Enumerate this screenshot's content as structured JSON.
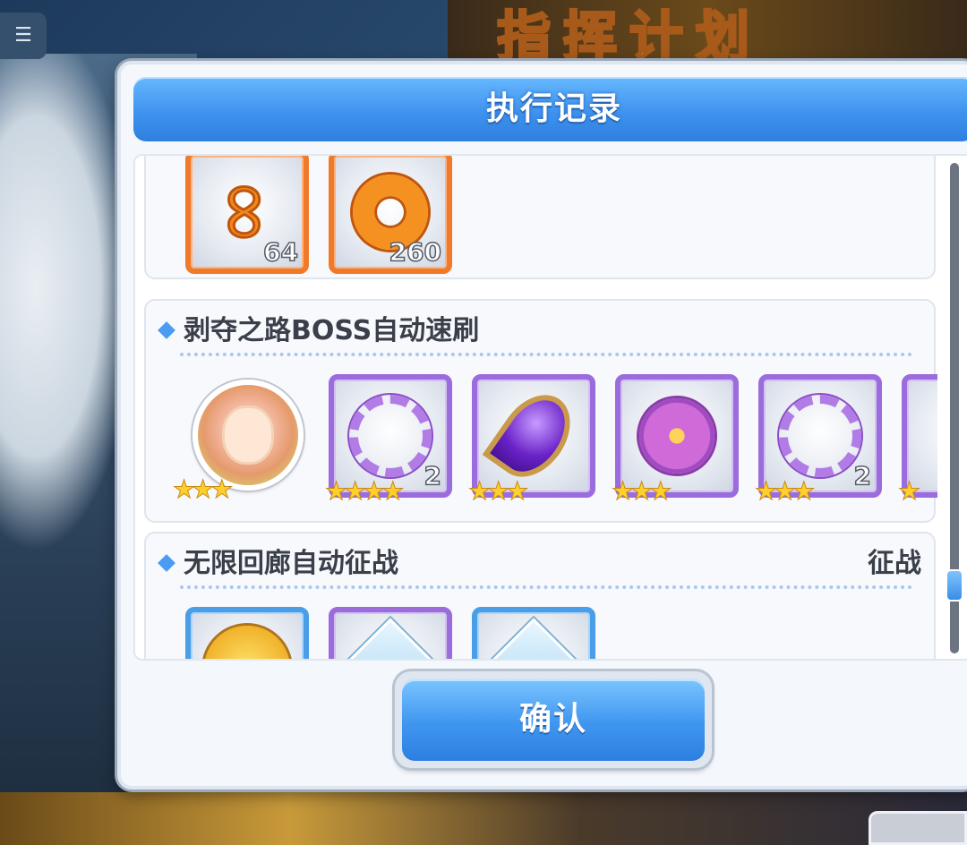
{
  "background": {
    "banner_text": "指挥计划",
    "corner_button_icon": "list-icon"
  },
  "dialog": {
    "title": "执行记录",
    "confirm_label": "确认"
  },
  "sections": [
    {
      "title": "",
      "items": [
        {
          "icon": "infinity-token-icon",
          "rarity": "orange",
          "count": "64"
        },
        {
          "icon": "ring-token-icon",
          "rarity": "orange",
          "count": "260"
        }
      ]
    },
    {
      "title": "剥夺之路BOSS自动速刷",
      "right_label": "",
      "items": [
        {
          "icon": "character-avatar",
          "rarity": "avatar",
          "stars": 3
        },
        {
          "icon": "laurel-wreath-icon",
          "rarity": "purple",
          "count": "2",
          "stars": 4
        },
        {
          "icon": "purple-leaf-icon",
          "rarity": "purple",
          "count": "",
          "stars": 3
        },
        {
          "icon": "purple-flower-icon",
          "rarity": "purple",
          "count": "",
          "stars": 3
        },
        {
          "icon": "laurel-wreath-icon",
          "rarity": "purple",
          "count": "2",
          "stars": 3
        }
      ]
    },
    {
      "title": "无限回廊自动征战",
      "right_label": "征战",
      "items": [
        {
          "icon": "gold-coin-icon",
          "rarity": "blue"
        },
        {
          "icon": "crystal-shard-icon",
          "rarity": "purple"
        },
        {
          "icon": "crystal-shard-icon",
          "rarity": "blue"
        }
      ]
    }
  ],
  "star_glyphs": {
    "three": "★★★",
    "four": "★★★★"
  },
  "scroll": {
    "position_fraction": 0.83
  },
  "colors": {
    "header_blue": "#3f93ee",
    "orange_rarity": "#f07a2a",
    "purple_rarity": "#9a6cdc",
    "blue_rarity": "#4a9ee8",
    "star_yellow": "#ffcf2e"
  }
}
